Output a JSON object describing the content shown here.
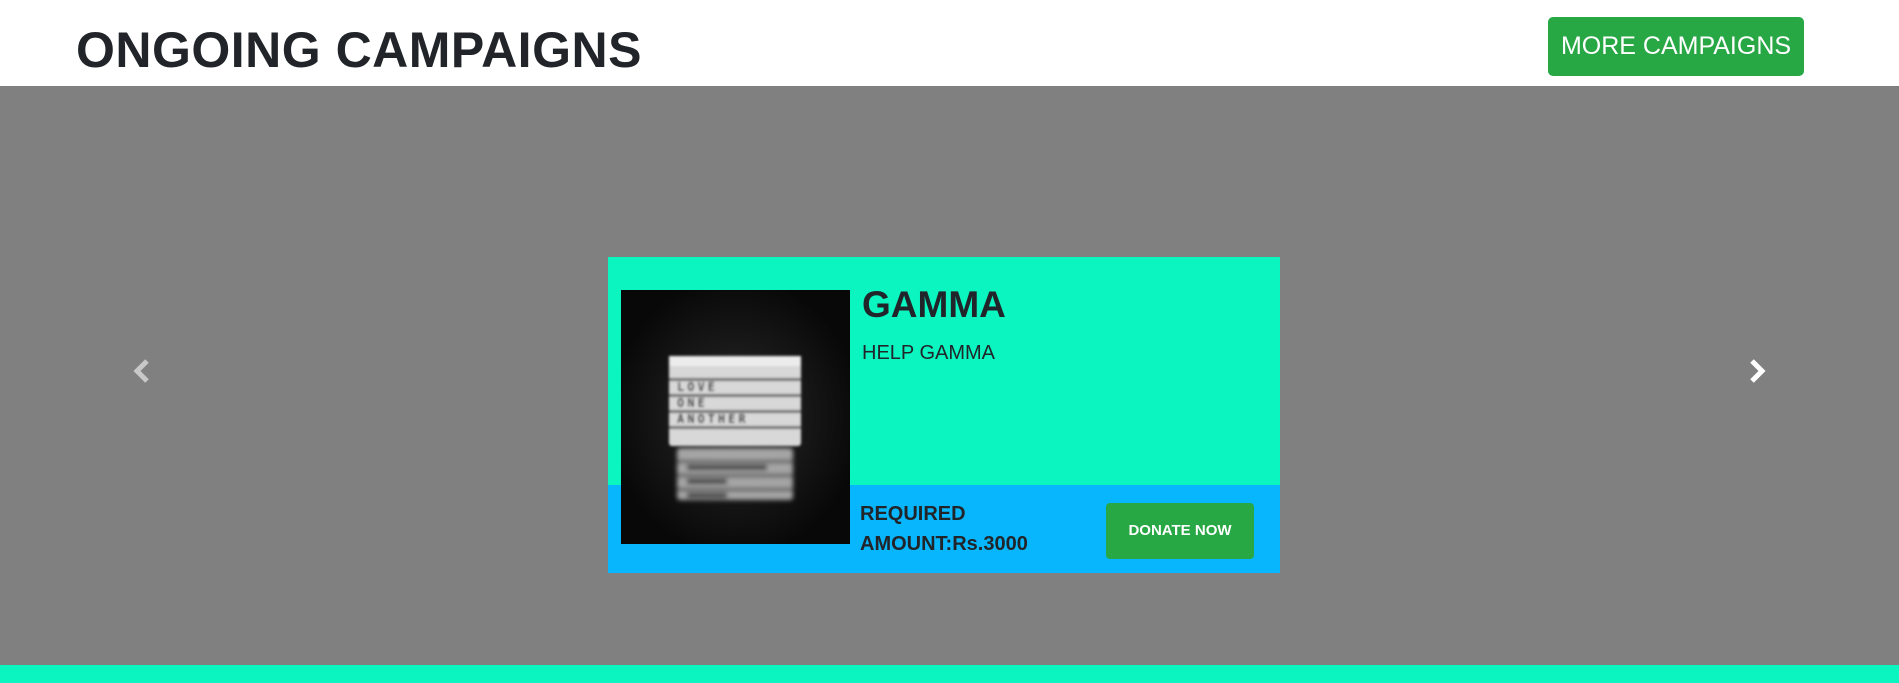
{
  "header": {
    "title": "ONGOING CAMPAIGNS",
    "more_button_label": "MORE CAMPAIGNS"
  },
  "carousel": {
    "prev_icon": "chevron-left-icon",
    "next_icon": "chevron-right-icon",
    "slide": {
      "name": "GAMMA",
      "description": "HELP GAMMA",
      "required_label": "REQUIRED",
      "amount_label": "AMOUNT:Rs.3000",
      "donate_button_label": "DONATE NOW",
      "image_text": [
        "LOVE",
        "ONE",
        "ANOTHER"
      ]
    }
  },
  "colors": {
    "accent_green": "#28a745",
    "card_top": "#0bf5c1",
    "card_bottom": "#08b6fd",
    "carousel_bg": "#808080",
    "footer_band": "#0bf5c1"
  }
}
